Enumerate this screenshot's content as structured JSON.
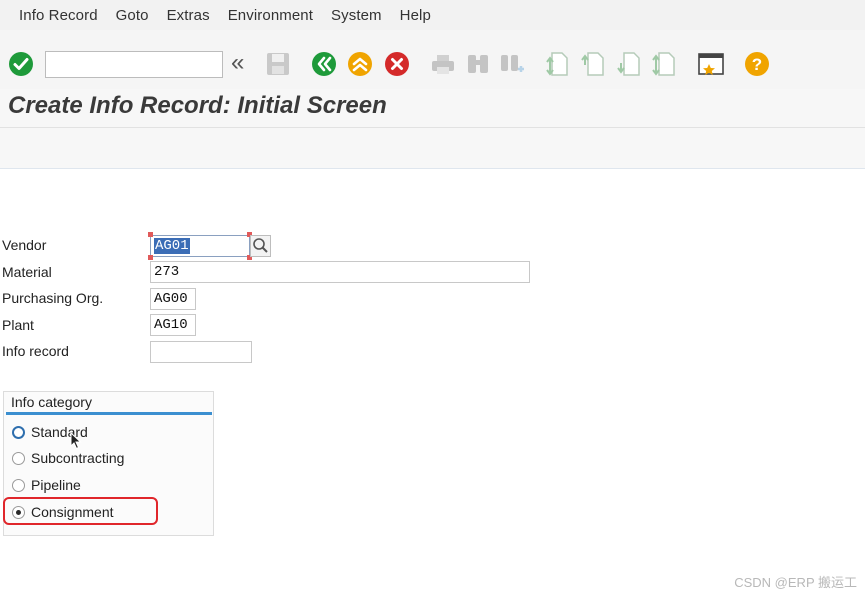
{
  "menu": [
    "Info Record",
    "Goto",
    "Extras",
    "Environment",
    "System",
    "Help"
  ],
  "toolbar": {
    "command_value": "",
    "icons": [
      "enter-icon",
      "save-icon",
      "back-icon",
      "exit-icon",
      "cancel-icon",
      "print-icon",
      "find-icon",
      "find-next-icon",
      "first-page-icon",
      "previous-page-icon",
      "next-page-icon",
      "last-page-icon",
      "layout-icon",
      "help-icon"
    ],
    "colors": {
      "green": "#1e9a3a",
      "orange": "#f0a400",
      "red": "#d42a2a"
    }
  },
  "title": "Create Info Record: Initial Screen",
  "form": {
    "vendor": {
      "label": "Vendor",
      "value": "AG01"
    },
    "material": {
      "label": "Material",
      "value": "273"
    },
    "purch_org": {
      "label": "Purchasing Org.",
      "value": "AG00"
    },
    "plant": {
      "label": "Plant",
      "value": "AG10"
    },
    "info_record": {
      "label": "Info record",
      "value": ""
    }
  },
  "info_category": {
    "title": "Info category",
    "options": [
      {
        "label": "Standard",
        "selected": false
      },
      {
        "label": "Subcontracting",
        "selected": false
      },
      {
        "label": "Pipeline",
        "selected": false
      },
      {
        "label": "Consignment",
        "selected": true
      }
    ]
  },
  "watermark": "CSDN @ERP 搬运工"
}
